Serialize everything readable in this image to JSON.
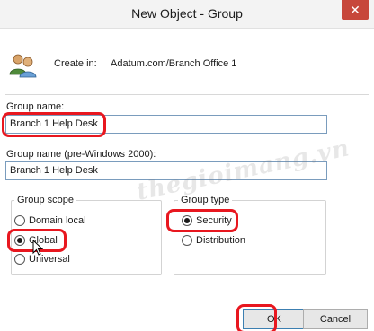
{
  "window": {
    "title": "New Object - Group",
    "close_glyph": "✕"
  },
  "create_in": {
    "label": "Create in:",
    "value": "Adatum.com/Branch Office 1",
    "icon": "group-users-icon"
  },
  "group_name": {
    "label": "Group name:",
    "value": "Branch 1 Help Desk"
  },
  "group_name_pre2000": {
    "label": "Group name (pre-Windows 2000):",
    "value": "Branch 1 Help Desk"
  },
  "group_scope": {
    "legend": "Group scope",
    "options": [
      {
        "label": "Domain local",
        "checked": false
      },
      {
        "label": "Global",
        "checked": true
      },
      {
        "label": "Universal",
        "checked": false
      }
    ]
  },
  "group_type": {
    "legend": "Group type",
    "options": [
      {
        "label": "Security",
        "checked": true
      },
      {
        "label": "Distribution",
        "checked": false
      }
    ]
  },
  "buttons": {
    "ok": "OK",
    "cancel": "Cancel"
  },
  "watermark": "thegioimang.vn",
  "colors": {
    "highlight": "#e8171f",
    "title_bar": "#f3f3f3",
    "close_button": "#c7473b"
  }
}
